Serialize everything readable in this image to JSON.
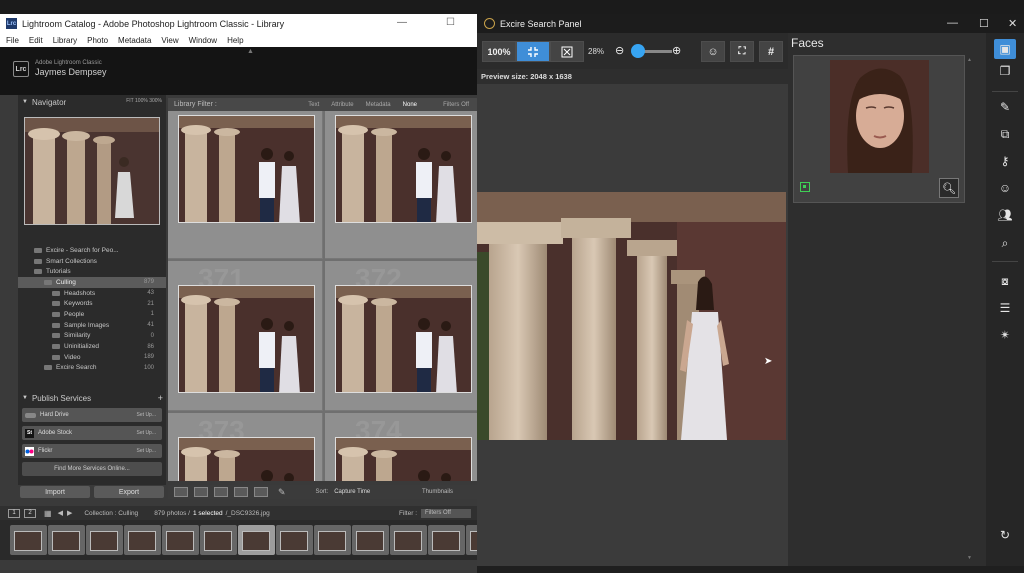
{
  "lightroom": {
    "window_title": "Lightroom Catalog - Adobe Photoshop Lightroom Classic - Library",
    "app_icon": "Lrc",
    "menu": [
      "File",
      "Edit",
      "Library",
      "Photo",
      "Metadata",
      "View",
      "Window",
      "Help"
    ],
    "identity": {
      "badge": "Lrc",
      "app_name": "Adobe Lightroom Classic",
      "user_name": "Jaymes Dempsey"
    },
    "navigator": {
      "title": "Navigator",
      "zoom_options": "FIT   100%   300%"
    },
    "folders": [
      {
        "name": "Excire - Search for Peo...",
        "count": ""
      },
      {
        "name": "Smart Collections",
        "count": ""
      },
      {
        "name": "Tutorials",
        "count": ""
      },
      {
        "name": "Culling",
        "count": "879",
        "selected": true
      },
      {
        "name": "Headshots",
        "count": "43"
      },
      {
        "name": "Keywords",
        "count": "21"
      },
      {
        "name": "People",
        "count": "1"
      },
      {
        "name": "Sample Images",
        "count": "41"
      },
      {
        "name": "Similarity",
        "count": "0"
      },
      {
        "name": "Uninitialized",
        "count": "86"
      },
      {
        "name": "Video",
        "count": "189"
      },
      {
        "name": "Excire Search",
        "count": "100"
      }
    ],
    "publish": {
      "title": "Publish Services",
      "services": [
        {
          "name": "Hard Drive",
          "action": "Set Up...",
          "icon": "hard-drive-icon"
        },
        {
          "name": "Adobe Stock",
          "action": "Set Up...",
          "icon": "adobe-stock-icon",
          "badge": "St"
        },
        {
          "name": "Flickr",
          "action": "Set Up...",
          "icon": "flickr-icon"
        }
      ],
      "find_more": "Find More Services Online..."
    },
    "import_label": "Import",
    "export_label": "Export",
    "filter_bar": {
      "title": "Library Filter :",
      "options": [
        "Text",
        "Attribute",
        "Metadata",
        "None"
      ],
      "selected": "None",
      "filters_off": "Filters Off"
    },
    "grid_cells": [
      "",
      "",
      "",
      "",
      "371",
      "372",
      "",
      "373",
      "374"
    ],
    "toolbar": {
      "sort_label": "Sort:",
      "sort_value": "Capture Time",
      "thumbnails_label": "Thumbnails"
    },
    "filmstrip_header": {
      "pages": [
        "1",
        "2"
      ],
      "breadcrumb": "Collection : Culling",
      "count": "879 photos /",
      "selected": "1 selected",
      "filename": "/_DSC9326.jpg",
      "filter_label": "Filter :",
      "filter_value": "Filters Off"
    },
    "filmstrip_count": 13,
    "filmstrip_selected_index": 6
  },
  "excire": {
    "window_title": "Excire Search Panel",
    "toolbar": {
      "zoom_100": "100%",
      "zoom_value": "28%",
      "zoom_fraction": 0.1,
      "buttons": [
        "fit-icon",
        "fill-icon",
        "zoom-out-icon",
        "zoom-in-icon",
        "face-detect-icon",
        "frame-icon",
        "grid-icon"
      ]
    },
    "preview_size": "Preview size: 2048 x 1638",
    "faces": {
      "title": "Faces"
    },
    "sidebar_icons": [
      "image-icon",
      "collection-icon",
      "edit-icon",
      "duplicate-icon",
      "key-icon",
      "face-icon",
      "people-icon",
      "search-icon",
      "image-search-icon",
      "sort-icon",
      "magic-icon",
      "refresh-icon"
    ],
    "colors": {
      "accent": "#3f8ed8",
      "face_marker": "#3fcf55"
    }
  }
}
